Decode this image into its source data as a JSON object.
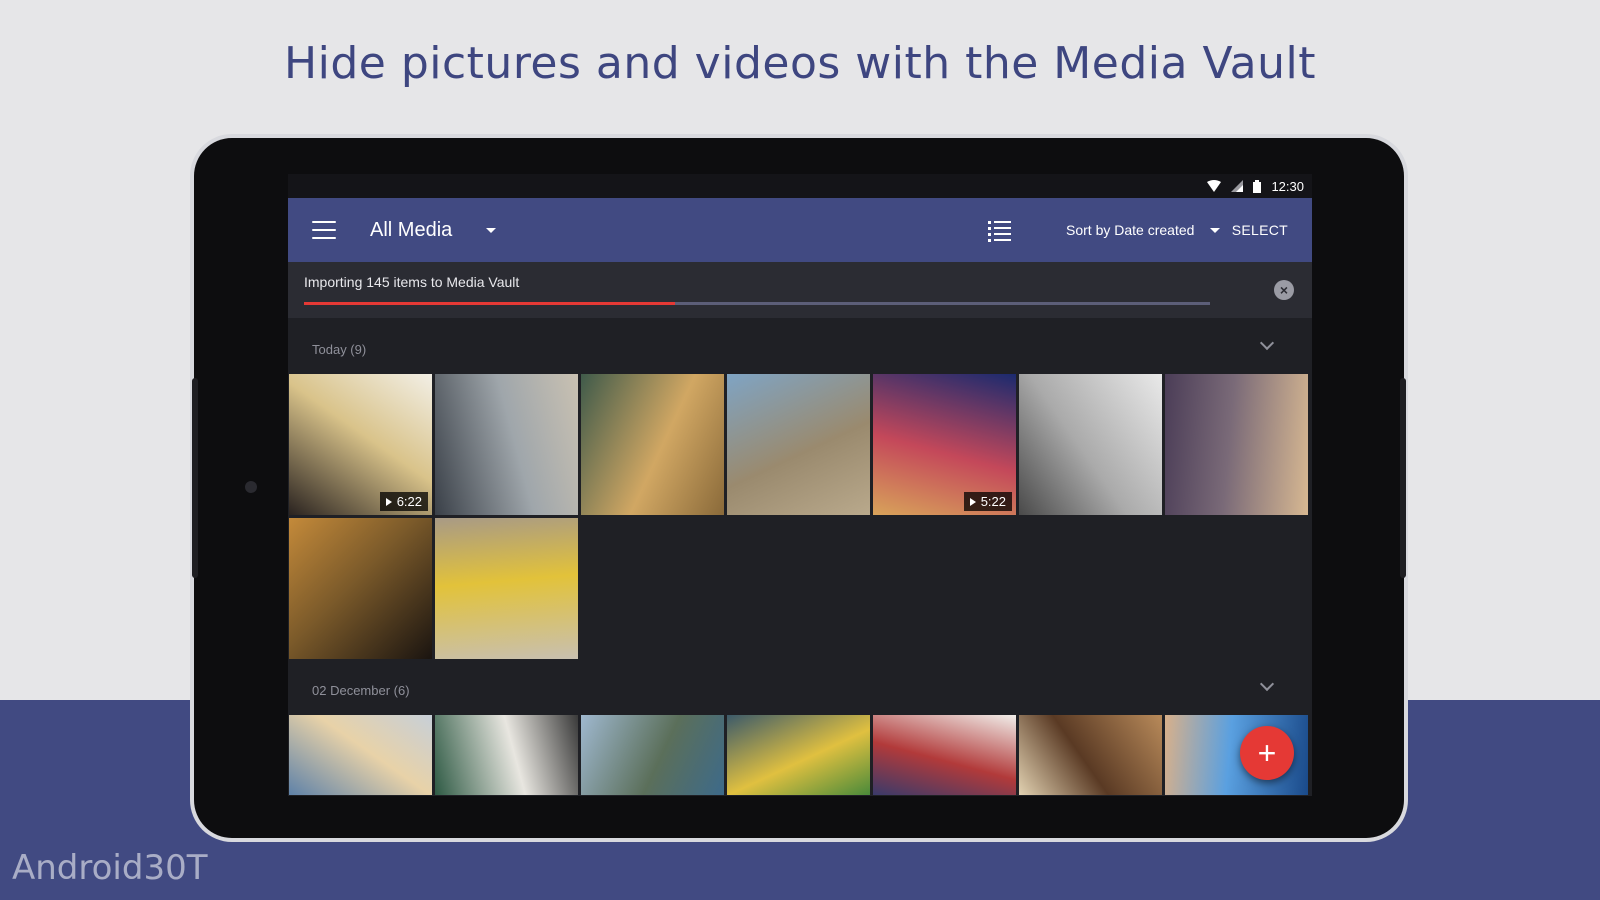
{
  "headline": "Hide pictures and videos with the Media Vault",
  "status": {
    "time": "12:30"
  },
  "appbar": {
    "title": "All Media",
    "sort_label": "Sort by Date created",
    "select_label": "SELECT"
  },
  "import": {
    "text": "Importing 145 items to Media Vault",
    "progress": 0.41
  },
  "sections": [
    {
      "label": "Today (9)",
      "thumbs": [
        {
          "name": "fried-egg",
          "colors": [
            "#2a2320",
            "#d9c38a",
            "#f2efe6"
          ],
          "duration": "6:22"
        },
        {
          "name": "car-window-legs",
          "colors": [
            "#3a4048",
            "#9fa6ab",
            "#c9c1b2"
          ],
          "duration": ""
        },
        {
          "name": "guitar-girl",
          "colors": [
            "#3f5a4a",
            "#d1a763",
            "#8a6a3a"
          ],
          "duration": ""
        },
        {
          "name": "beach-dog",
          "colors": [
            "#7fa4c4",
            "#9a8a6e",
            "#b9a98c"
          ],
          "duration": ""
        },
        {
          "name": "party-girls",
          "colors": [
            "#1b2a6e",
            "#c4485a",
            "#d8a35a"
          ],
          "duration": "5:22"
        },
        {
          "name": "bicycle",
          "colors": [
            "#e9e9e9",
            "#aaaaaa",
            "#4a4a4a"
          ],
          "duration": ""
        },
        {
          "name": "sunset-shore",
          "colors": [
            "#d7b892",
            "#7a6a78",
            "#4b3d57"
          ],
          "duration": ""
        },
        {
          "name": "city-lights",
          "colors": [
            "#1a1410",
            "#7b5a2a",
            "#c48a3a"
          ],
          "duration": ""
        },
        {
          "name": "surfboard-legs",
          "colors": [
            "#c8c0b0",
            "#e2c23a",
            "#a89a86"
          ],
          "duration": ""
        }
      ]
    },
    {
      "label": "02 December (6)",
      "thumbs": [
        {
          "name": "cloud-sea",
          "colors": [
            "#5f82a8",
            "#e8d2a8",
            "#c7cfd8"
          ],
          "duration": ""
        },
        {
          "name": "adventure-patch",
          "colors": [
            "#2e5a44",
            "#e8e6e0",
            "#3a3a3a"
          ],
          "duration": ""
        },
        {
          "name": "coast-cliffs",
          "colors": [
            "#9fb8cf",
            "#5b6f5a",
            "#3d6a8a"
          ],
          "duration": ""
        },
        {
          "name": "lemon-drink",
          "colors": [
            "#3c5a6a",
            "#e0c040",
            "#4a8a3a"
          ],
          "duration": ""
        },
        {
          "name": "berries-bowl",
          "colors": [
            "#f1eeea",
            "#b23a3a",
            "#3a3a6a"
          ],
          "duration": ""
        },
        {
          "name": "dessert",
          "colors": [
            "#b88a5a",
            "#5a3a24",
            "#e2d2b2"
          ],
          "duration": ""
        },
        {
          "name": "crowd-bokeh",
          "colors": [
            "#1a4a8a",
            "#5aa0e0",
            "#d8b08a"
          ],
          "duration": ""
        }
      ]
    }
  ],
  "watermark": "Android30T",
  "colors": {
    "accent": "#414a82",
    "fab": "#e53935",
    "progress": "#e53935"
  }
}
